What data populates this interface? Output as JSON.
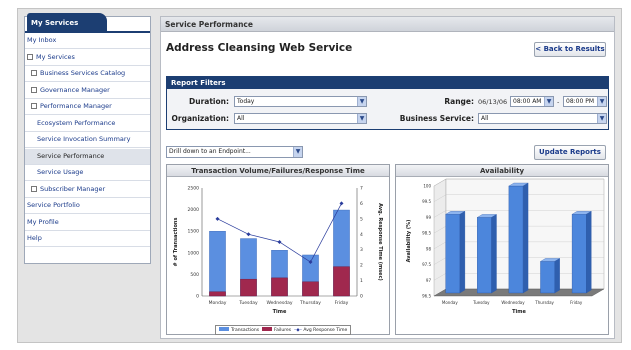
{
  "sidebar": {
    "tab_label": "My Services",
    "items": [
      {
        "label": "My Inbox",
        "level": 0,
        "checkbox": false,
        "selected": false
      },
      {
        "label": "My Services",
        "level": 0,
        "checkbox": true,
        "selected": false
      },
      {
        "label": "Business Services Catalog",
        "level": 1,
        "checkbox": true,
        "selected": false
      },
      {
        "label": "Governance Manager",
        "level": 1,
        "checkbox": true,
        "selected": false
      },
      {
        "label": "Performance Manager",
        "level": 1,
        "checkbox": true,
        "selected": false
      },
      {
        "label": "Ecosystem Performance",
        "level": 2,
        "checkbox": false,
        "selected": false
      },
      {
        "label": "Service Invocation Summary",
        "level": 2,
        "checkbox": false,
        "selected": false
      },
      {
        "label": "Service Performance",
        "level": 2,
        "checkbox": false,
        "selected": true
      },
      {
        "label": "Service Usage",
        "level": 2,
        "checkbox": false,
        "selected": false
      },
      {
        "label": "Subscriber Manager",
        "level": 1,
        "checkbox": true,
        "selected": false
      },
      {
        "label": "Service Portfolio",
        "level": 0,
        "checkbox": false,
        "selected": false
      },
      {
        "label": "My Profile",
        "level": 0,
        "checkbox": false,
        "selected": false
      },
      {
        "label": "Help",
        "level": 0,
        "checkbox": false,
        "selected": false
      }
    ]
  },
  "header": {
    "title": "Service Performance"
  },
  "page": {
    "title": "Address Cleansing Web Service",
    "back_button": "< Back to Results"
  },
  "filters": {
    "title": "Report Filters",
    "duration_label": "Duration:",
    "duration_value": "Today",
    "organization_label": "Organization:",
    "organization_value": "All",
    "range_label": "Range:",
    "range_date": "06/13/06",
    "range_from": "08:00 AM",
    "range_sep": "-",
    "range_to": "08:00 PM",
    "business_service_label": "Business Service:",
    "business_service_value": "All"
  },
  "drill": {
    "value": "Drill down to an Endpoint..."
  },
  "update_button": "Update Reports",
  "colors": {
    "navy": "#1c3e72",
    "transactions": "#5b8fe0",
    "failures": "#a0284e",
    "line": "#2a3c9c",
    "bar3d": "#4c86dc"
  },
  "chart_data": [
    {
      "type": "bar",
      "title": "Transaction Volume/Failures/Response Time",
      "categories": [
        "Monday",
        "Tuesday",
        "Wednesday",
        "Thursday",
        "Friday"
      ],
      "xlabel": "Time",
      "ylabel": "# of Transactions",
      "y2label": "Avg. Response Time (msec)",
      "ylim": [
        0,
        2500
      ],
      "y2lim": [
        0,
        7
      ],
      "yticks": [
        0,
        500,
        1000,
        1500,
        2000,
        2500
      ],
      "y2ticks": [
        0,
        1,
        2,
        3,
        4,
        5,
        6,
        7
      ],
      "series": [
        {
          "name": "Transactions",
          "values": [
            1500,
            1330,
            1060,
            950,
            1990
          ]
        },
        {
          "name": "Failures",
          "values": [
            100,
            390,
            420,
            330,
            680
          ]
        },
        {
          "name": "Avg Response Time",
          "values": [
            5.0,
            4.0,
            3.5,
            2.2,
            6.0
          ]
        }
      ],
      "legend": "bottom"
    },
    {
      "type": "bar",
      "title": "Availability",
      "categories": [
        "Monday",
        "Tuesday",
        "Wednesday",
        "Thursday",
        "Friday"
      ],
      "xlabel": "Time",
      "ylabel": "Availability (%)",
      "ylim": [
        96.5,
        100
      ],
      "yticks": [
        "96.5",
        "97",
        "97.5",
        "98",
        "98.5",
        "99",
        "99.5",
        "100"
      ],
      "values": [
        99.1,
        99.0,
        100.0,
        97.6,
        99.1
      ]
    }
  ]
}
